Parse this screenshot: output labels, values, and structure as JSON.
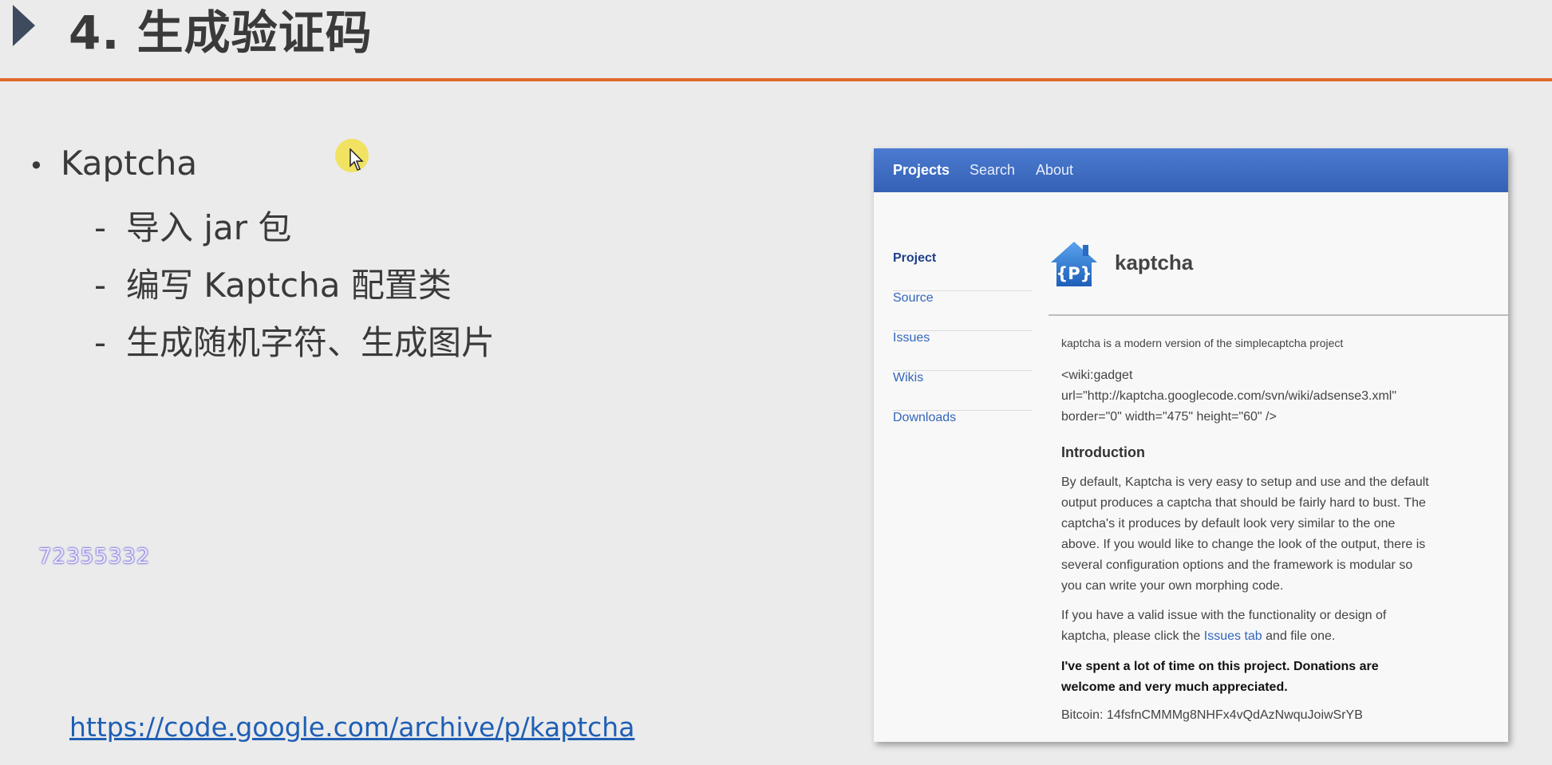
{
  "slide": {
    "title": "4. 生成验证码",
    "bullet": "Kaptcha",
    "sub_items": [
      "导入 jar 包",
      "编写 Kaptcha 配置类",
      "生成随机字符、生成图片"
    ],
    "watermark": "72355332",
    "link": "https://code.google.com/archive/p/kaptcha"
  },
  "browser": {
    "nav": {
      "projects": "Projects",
      "search": "Search",
      "about": "About"
    },
    "sidebar": [
      {
        "label": "Project",
        "active": true
      },
      {
        "label": "Source"
      },
      {
        "label": "Issues"
      },
      {
        "label": "Wikis"
      },
      {
        "label": "Downloads"
      }
    ],
    "logo_text": "{P}",
    "project_name": "kaptcha",
    "description": "kaptcha is a modern version of the simplecaptcha project",
    "code_lines": [
      "<wiki:gadget",
      "url=\"http://kaptcha.googlecode.com/svn/wiki/adsense3.xml\"",
      "border=\"0\" width=\"475\" height=\"60\" />"
    ],
    "intro_heading": "Introduction",
    "intro_lines": [
      "By default, Kaptcha is very easy to setup and use and the default",
      "output produces a captcha that should be fairly hard to bust. The",
      "captcha's it produces by default look very similar to the one",
      "above. If you would like to change the look of the output, there is",
      "several configuration options and the framework is modular so",
      "you can write your own morphing code."
    ],
    "issue_line1": "If you have a valid issue with the functionality or design of",
    "issue_pre": "kaptcha, please click the ",
    "issue_link": "Issues tab",
    "issue_post": " and file one.",
    "donation_lines": [
      "I've spent a lot of time on this project. Donations are",
      "welcome and very much appreciated."
    ],
    "bitcoin": "Bitcoin: 14fsfnCMMMg8NHFx4vQdAzNwquJoiwSrYB"
  },
  "colors": {
    "accent_rule": "#e06a2b",
    "topbar": "#3d6cc0",
    "link": "#3366bb"
  }
}
